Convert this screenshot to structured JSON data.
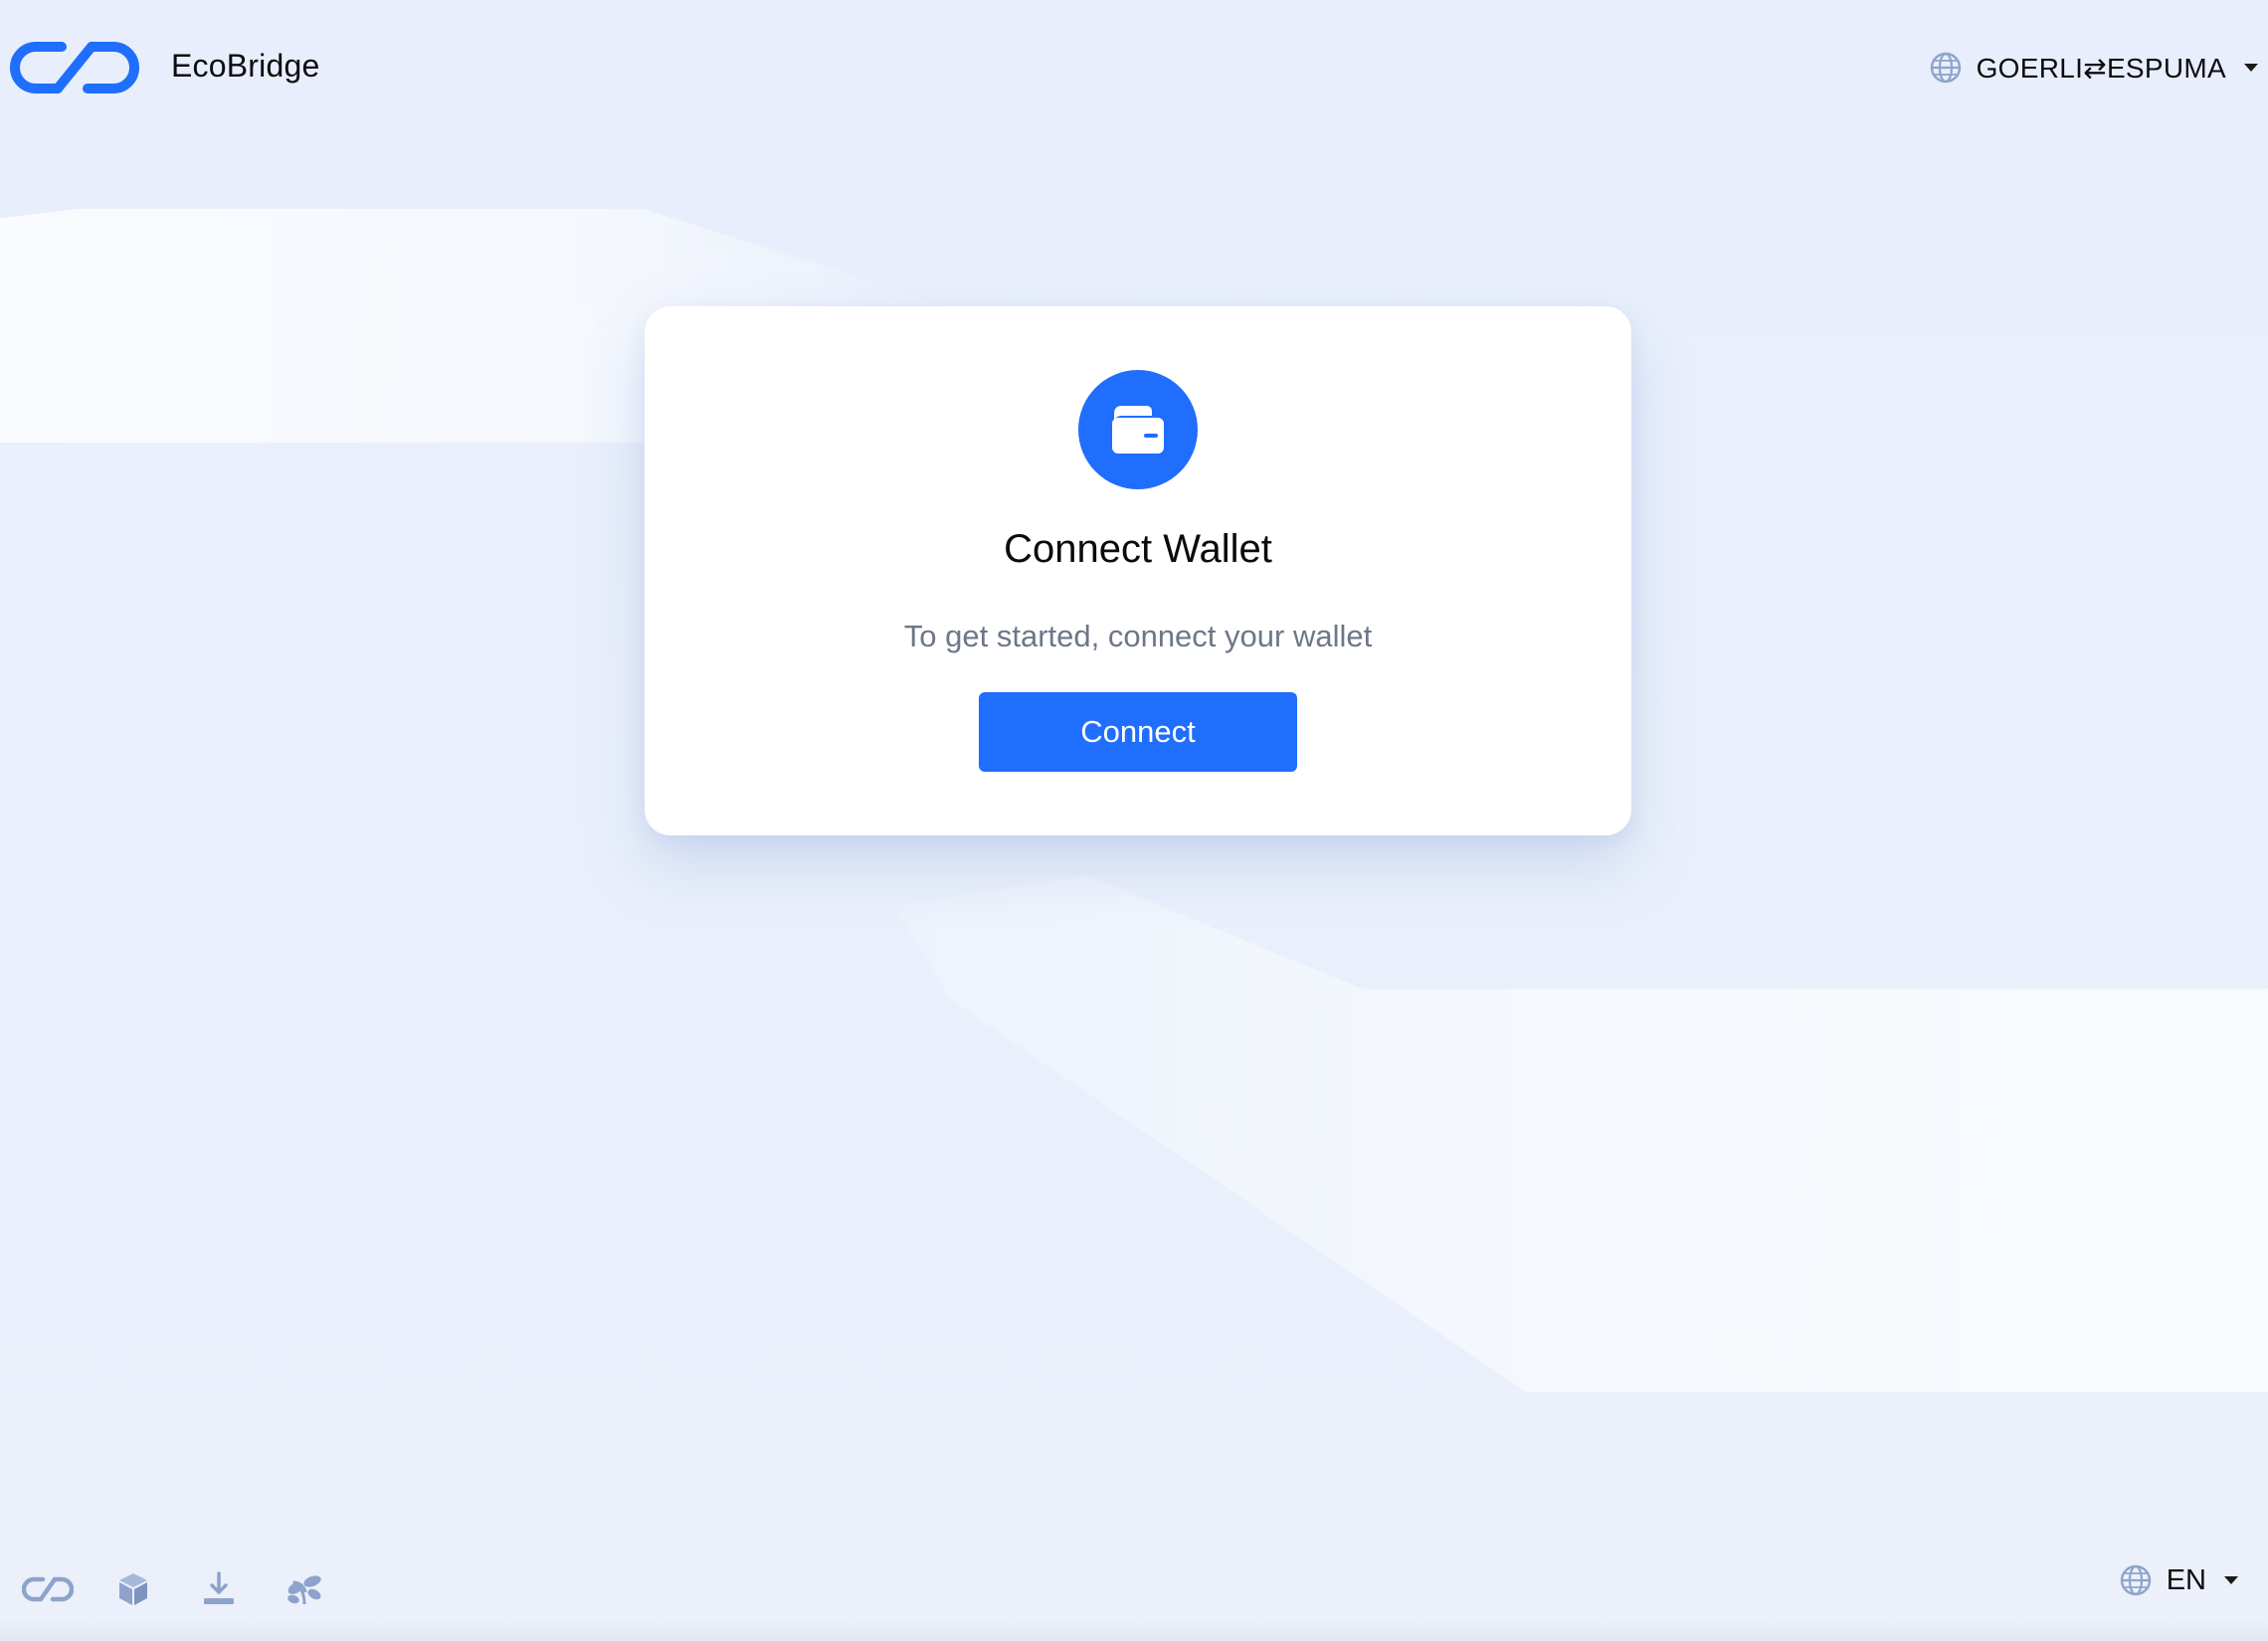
{
  "header": {
    "brand_name": "EcoBridge",
    "logo_icon": "chain-link-logo",
    "network_selector": {
      "icon": "globe-icon",
      "label": "GOERLI⇄ESPUMA",
      "dropdown_icon": "caret-down-icon"
    }
  },
  "card": {
    "icon": "wallet-icon",
    "title": "Connect Wallet",
    "subtitle": "To get started, connect your wallet",
    "connect_button_label": "Connect"
  },
  "footer": {
    "icons": [
      "chain-link-icon",
      "cube-icon",
      "download-icon",
      "plant-icon"
    ],
    "language_selector": {
      "icon": "globe-icon",
      "label": "EN",
      "dropdown_icon": "caret-down-icon"
    }
  },
  "colors": {
    "accent": "#1f6efd",
    "background": "#e9effb",
    "card": "#ffffff",
    "muted_text": "#6d7789",
    "footer_icon": "#8ea3cc"
  }
}
